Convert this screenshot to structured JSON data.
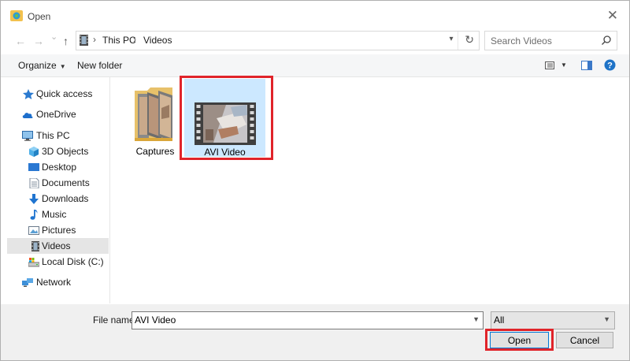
{
  "window": {
    "title": "Open",
    "close_glyph": "✕"
  },
  "nav": {
    "back_glyph": "←",
    "forward_glyph": "→",
    "recent_glyph": "⌄",
    "up_glyph": "↑",
    "breadcrumb": [
      "This PC",
      "Videos"
    ],
    "crumb_separator": "›",
    "refresh_glyph": "↻"
  },
  "search": {
    "placeholder": "Search Videos"
  },
  "toolbar": {
    "organize_label": "Organize",
    "new_folder_label": "New folder"
  },
  "sidebar": {
    "items": [
      {
        "label": "Quick access",
        "icon": "star-icon"
      },
      {
        "label": "OneDrive",
        "icon": "cloud-icon"
      },
      {
        "label": "This PC",
        "icon": "computer-icon"
      },
      {
        "label": "3D Objects",
        "icon": "cube-icon"
      },
      {
        "label": "Desktop",
        "icon": "desktop-icon"
      },
      {
        "label": "Documents",
        "icon": "document-icon"
      },
      {
        "label": "Downloads",
        "icon": "download-icon"
      },
      {
        "label": "Music",
        "icon": "music-icon"
      },
      {
        "label": "Pictures",
        "icon": "pictures-icon"
      },
      {
        "label": "Videos",
        "icon": "video-icon",
        "selected": true
      },
      {
        "label": "Local Disk (C:)",
        "icon": "disk-icon"
      },
      {
        "label": "Network",
        "icon": "network-icon"
      }
    ]
  },
  "files": [
    {
      "name": "Captures",
      "type": "folder"
    },
    {
      "name": "AVI Video",
      "type": "video",
      "selected": true
    }
  ],
  "footer": {
    "file_name_label": "File name:",
    "file_name_value": "AVI Video",
    "filter_value": "All",
    "open_label": "Open",
    "cancel_label": "Cancel"
  },
  "colors": {
    "highlight": "#e0242a",
    "selection": "#cce8ff",
    "accent": "#0078d7"
  }
}
